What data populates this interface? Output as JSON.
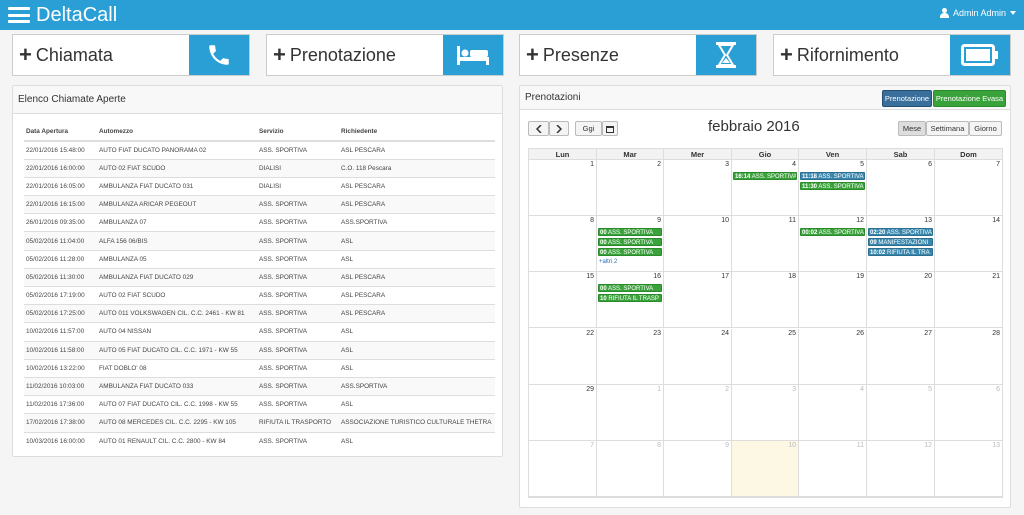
{
  "app": {
    "title": "DeltaCall",
    "user": "Admin Admin"
  },
  "actions": [
    {
      "label": "Chiamata",
      "icon": "phone-icon"
    },
    {
      "label": "Prenotazione",
      "icon": "bed-icon"
    },
    {
      "label": "Presenze",
      "icon": "hourglass-icon"
    },
    {
      "label": "Rifornimento",
      "icon": "battery-icon"
    }
  ],
  "calls_panel": {
    "title": "Elenco Chiamate Aperte",
    "headers": [
      "Data Apertura",
      "Automezzo",
      "Servizio",
      "Richiedente"
    ],
    "rows": [
      [
        "22/01/2016 15:48:00",
        "AUTO FIAT DUCATO PANORAMA 02",
        "ASS. SPORTIVA",
        "ASL PESCARA"
      ],
      [
        "22/01/2016 16:00:00",
        "AUTO 02 FIAT SCUDO",
        "DIALISI",
        "C.O. 118 Pescara"
      ],
      [
        "22/01/2016 16:05:00",
        "AMBULANZA FIAT DUCATO 031",
        "DIALISI",
        "ASL PESCARA"
      ],
      [
        "22/01/2016 16:15:00",
        "AMBULANZA ARICAR PEGEOUT",
        "ASS. SPORTIVA",
        "ASL PESCARA"
      ],
      [
        "26/01/2016 09:35:00",
        "AMBULANZA 07",
        "ASS. SPORTIVA",
        "ASS.SPORTIVA"
      ],
      [
        "05/02/2016 11:04:00",
        "ALFA 156 06/BIS",
        "ASS. SPORTIVA",
        "ASL"
      ],
      [
        "05/02/2016 11:28:00",
        "AMBULANZA 05",
        "ASS. SPORTIVA",
        "ASL"
      ],
      [
        "05/02/2016 11:30:00",
        "AMBULANZA FIAT DUCATO 029",
        "ASS. SPORTIVA",
        "ASL PESCARA"
      ],
      [
        "05/02/2016 17:19:00",
        "AUTO 02 FIAT SCUDO",
        "ASS. SPORTIVA",
        "ASL PESCARA"
      ],
      [
        "05/02/2016 17:25:00",
        "AUTO 011 VOLKSWAGEN CIL. C.C. 2461 - KW 81",
        "ASS. SPORTIVA",
        "ASL PESCARA"
      ],
      [
        "10/02/2016 11:57:00",
        "AUTO 04 NISSAN",
        "ASS. SPORTIVA",
        "ASL"
      ],
      [
        "10/02/2016 11:58:00",
        "AUTO 05 FIAT DUCATO CIL. C.C. 1971 - KW 55",
        "ASS. SPORTIVA",
        "ASL"
      ],
      [
        "10/02/2016 13:22:00",
        "FIAT DOBLO' 08",
        "ASS. SPORTIVA",
        "ASL"
      ],
      [
        "11/02/2016 10:03:00",
        "AMBULANZA FIAT DUCATO 033",
        "ASS. SPORTIVA",
        "ASS.SPORTIVA"
      ],
      [
        "11/02/2016 17:36:00",
        "AUTO 07 FIAT DUCATO CIL. C.C. 1998 - KW 55",
        "ASS. SPORTIVA",
        "ASL"
      ],
      [
        "17/02/2016 17:38:00",
        "AUTO 08 MERCEDES CIL. C.C. 2295 - KW 105",
        "RIFIUTA IL TRASPORTO",
        "ASSOCIAZIONE TURISTICO CULTURALE THETRA"
      ],
      [
        "10/03/2016 16:00:00",
        "AUTO 01 RENAULT CIL. C.C. 2800 - KW 84",
        "ASS. SPORTIVA",
        "ASL"
      ]
    ]
  },
  "bookings_panel": {
    "title": "Prenotazioni",
    "btn_prenotazione": "Prenotazione",
    "btn_evasa": "Prenotazione Evasa",
    "today_label": "Ggi",
    "month_title": "febbraio 2016",
    "views": [
      "Mese",
      "Settimana",
      "Giorno"
    ],
    "days": [
      "Lun",
      "Mar",
      "Mer",
      "Gio",
      "Ven",
      "Sab",
      "Dom"
    ],
    "weeks": [
      [
        [
          "1",
          false
        ],
        [
          "2",
          false
        ],
        [
          "3",
          false
        ],
        [
          "4",
          false
        ],
        [
          "5",
          false
        ],
        [
          "6",
          false
        ],
        [
          "7",
          false
        ]
      ],
      [
        [
          "8",
          false
        ],
        [
          "9",
          false
        ],
        [
          "10",
          false
        ],
        [
          "11",
          false
        ],
        [
          "12",
          false
        ],
        [
          "13",
          false
        ],
        [
          "14",
          false
        ]
      ],
      [
        [
          "15",
          false
        ],
        [
          "16",
          false
        ],
        [
          "17",
          false
        ],
        [
          "18",
          false
        ],
        [
          "19",
          false
        ],
        [
          "20",
          false
        ],
        [
          "21",
          false
        ]
      ],
      [
        [
          "22",
          false
        ],
        [
          "23",
          false
        ],
        [
          "24",
          false
        ],
        [
          "25",
          false
        ],
        [
          "26",
          false
        ],
        [
          "27",
          false
        ],
        [
          "28",
          false
        ]
      ],
      [
        [
          "29",
          false
        ],
        [
          "1",
          true
        ],
        [
          "2",
          true
        ],
        [
          "3",
          true
        ],
        [
          "4",
          true
        ],
        [
          "5",
          true
        ],
        [
          "6",
          true
        ]
      ],
      [
        [
          "7",
          true
        ],
        [
          "8",
          true
        ],
        [
          "9",
          true
        ],
        [
          "10",
          true
        ],
        [
          "11",
          true
        ],
        [
          "12",
          true
        ],
        [
          "13",
          true
        ]
      ]
    ],
    "events": [
      {
        "week": 0,
        "day": 3,
        "slot": 0,
        "time": "16:14",
        "text": "ASS. SPORTIVA",
        "color": "green"
      },
      {
        "week": 0,
        "day": 4,
        "slot": 0,
        "time": "11:18",
        "text": "ASS. SPORTIVA",
        "color": "blue"
      },
      {
        "week": 0,
        "day": 4,
        "slot": 1,
        "time": "11:30",
        "text": "ASS. SPORTIVA",
        "color": "green"
      },
      {
        "week": 1,
        "day": 1,
        "slot": 0,
        "time": "00",
        "text": "ASS. SPORTIVA",
        "color": "green"
      },
      {
        "week": 1,
        "day": 1,
        "slot": 1,
        "time": "00",
        "text": "ASS. SPORTIVA",
        "color": "green"
      },
      {
        "week": 1,
        "day": 1,
        "slot": 2,
        "time": "00",
        "text": "ASS. SPORTIVA",
        "color": "green"
      },
      {
        "week": 1,
        "day": 4,
        "slot": 0,
        "time": "00:02",
        "text": "ASS. SPORTIVA",
        "color": "green"
      },
      {
        "week": 1,
        "day": 5,
        "slot": 0,
        "time": "02:20",
        "text": "ASS. SPORTIVA",
        "color": "blue"
      },
      {
        "week": 1,
        "day": 5,
        "slot": 1,
        "time": "09",
        "text": "MANIFESTAZIONI",
        "color": "blue"
      },
      {
        "week": 1,
        "day": 5,
        "slot": 2,
        "time": "10:02",
        "text": "RIFIUTA IL TRA",
        "color": "blue"
      },
      {
        "week": 2,
        "day": 1,
        "slot": 0,
        "time": "00",
        "text": "ASS. SPORTIVA",
        "color": "green"
      },
      {
        "week": 2,
        "day": 1,
        "slot": 1,
        "time": "10",
        "text": "RIFIUTA IL TRASP",
        "color": "green"
      }
    ],
    "more": {
      "week": 1,
      "day": 1,
      "text": "+altri 2"
    },
    "today": {
      "week": 5,
      "day": 3
    }
  },
  "colors": {
    "primary": "#2a9fd6",
    "event_green": "#3aa23a",
    "event_blue": "#3a87ad"
  }
}
